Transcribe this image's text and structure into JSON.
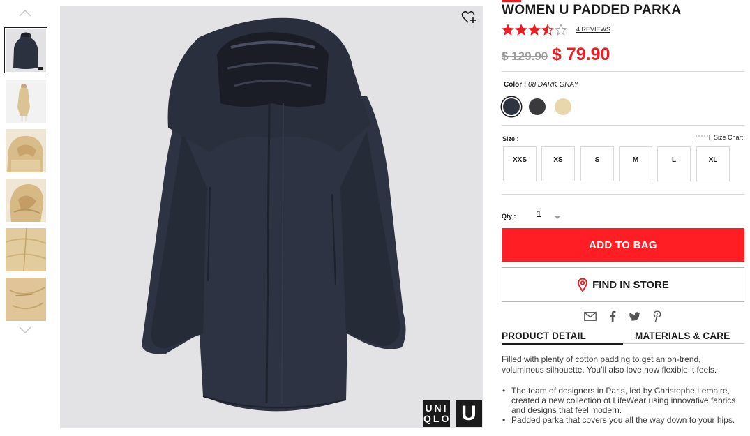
{
  "thumbnails": {
    "up_icon": "chevron-up-icon",
    "down_icon": "chevron-down-icon",
    "items": [
      {
        "alt": "dark gray parka front"
      },
      {
        "alt": "beige parka on model"
      },
      {
        "alt": "beige hood detail"
      },
      {
        "alt": "beige hood side"
      },
      {
        "alt": "beige fabric detail"
      },
      {
        "alt": "beige pocket detail"
      }
    ]
  },
  "main_image": {
    "alt": "Women U Padded Parka in dark gray",
    "wishlist_icon": "heart-plus-icon",
    "logo_uniqlo_line1": "UNI",
    "logo_uniqlo_line2": "QLO",
    "logo_u": "U"
  },
  "product": {
    "title": "WOMEN U PADDED PARKA",
    "rating": 3.5,
    "rating_max": 5,
    "reviews_label": "4 REVIEWS",
    "price_old": "$ 129.90",
    "price_new": "$ 79.90"
  },
  "color": {
    "label": "Color :",
    "value": "08 DARK GRAY",
    "swatches": [
      {
        "name": "dark-gray",
        "hex": "#2e3440",
        "selected": true
      },
      {
        "name": "black",
        "hex": "#3a3a3c",
        "selected": false
      },
      {
        "name": "beige",
        "hex": "#e8d7ad",
        "selected": false
      }
    ]
  },
  "size": {
    "label": "Size :",
    "chart_label": "Size Chart",
    "chart_icon": "ruler-icon",
    "options": [
      "XXS",
      "XS",
      "S",
      "M",
      "L",
      "XL"
    ]
  },
  "quantity": {
    "label": "Qty :",
    "value": "1",
    "caret_icon": "caret-down-icon"
  },
  "actions": {
    "add_to_bag": "ADD TO BAG",
    "find_in_store": "FIND IN STORE",
    "find_in_store_icon": "location-pin-icon"
  },
  "share": {
    "icons": [
      "email-icon",
      "facebook-icon",
      "twitter-icon",
      "pinterest-icon"
    ]
  },
  "tabs": {
    "product_detail": "PRODUCT DETAIL",
    "materials_care": "MATERIALS & CARE",
    "active": "product_detail"
  },
  "details": {
    "description": "Filled with plenty of cotton padding to get an on-trend, voluminous silhouette. You’ll also love how flexible it feels.",
    "bullets": [
      "The team of designers in Paris, led by Christophe Lemaire, created a new collection of LifeWear using innovative fabrics and designs that feel modern.",
      "Padded parka that covers you all the way down to your hips."
    ]
  },
  "colors": {
    "accent_red": "#ed1d24",
    "button_red": "#ff1e23",
    "text_dark": "#1b1b1b",
    "image_bg": "#e3e3e5"
  }
}
